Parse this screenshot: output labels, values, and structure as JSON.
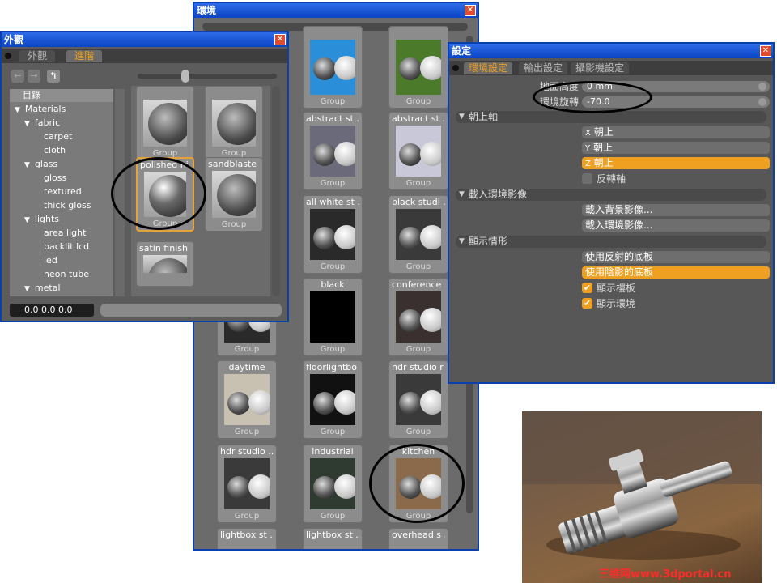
{
  "appearance": {
    "title": "外觀",
    "tabs": [
      "外觀",
      "進階"
    ],
    "tree_header": "目錄",
    "tree": [
      "Materials",
      "fabric",
      "carpet",
      "cloth",
      "glass",
      "gloss",
      "textured",
      "thick gloss",
      "lights",
      "area light",
      "backlit lcd",
      "led",
      "neon tube",
      "metal"
    ],
    "coords": "0.0   0.0   0.0",
    "thumbs": [
      {
        "label": "Group",
        "caption": ""
      },
      {
        "label": "Group",
        "caption": ""
      },
      {
        "label": "Group",
        "caption": "polished ni ..."
      },
      {
        "label": "Group",
        "caption": "sandblaste ..."
      },
      {
        "label": "",
        "caption": "satin finish ..."
      }
    ]
  },
  "environment": {
    "title": "環境",
    "thumbs": [
      {
        "caption": "",
        "label": "Group"
      },
      {
        "caption": "",
        "label": "Group"
      },
      {
        "caption": "abstract st ...",
        "label": "Group"
      },
      {
        "caption": "abstract st ...",
        "label": "Group"
      },
      {
        "caption": "all white st ...",
        "label": "Group"
      },
      {
        "caption": "black studi ...",
        "label": "Group"
      },
      {
        "caption": "",
        "label": "Group"
      },
      {
        "caption": "black",
        "label": "Group"
      },
      {
        "caption": "conference ...",
        "label": "Group"
      },
      {
        "caption": "daytime",
        "label": "Group"
      },
      {
        "caption": "floorlightbo ...",
        "label": "Group"
      },
      {
        "caption": "hdr studio r ...",
        "label": "Group"
      },
      {
        "caption": "hdr studio ...",
        "label": "Group"
      },
      {
        "caption": "industrial",
        "label": "Group"
      },
      {
        "caption": "kitchen",
        "label": "Group"
      },
      {
        "caption": "lightbox st ...",
        "label": ""
      },
      {
        "caption": "lightbox st ...",
        "label": ""
      },
      {
        "caption": "overhead s ...",
        "label": ""
      }
    ]
  },
  "settings": {
    "title": "設定",
    "tabs": [
      "環境設定",
      "輸出設定",
      "攝影機設定"
    ],
    "ground_height_label": "地面高度",
    "ground_height_value": "0 mm",
    "env_rotation_label": "環境旋轉",
    "env_rotation_value": "-70.0",
    "section_up_axis": "朝上軸",
    "x_up": "朝上",
    "y_up": "朝上",
    "z_up": "朝上",
    "axis_x": "X",
    "axis_y": "Y",
    "axis_z": "Z",
    "flip_axis": "反轉軸",
    "section_load": "載入環境影像",
    "load_background": "載入背景影像...",
    "load_environment": "載入環境影像...",
    "section_display": "顯示情形",
    "use_reflection_floor": "使用反射的底板",
    "use_shadow_floor": "使用陰影的底板",
    "show_floor": "顯示樓板",
    "show_environment": "顯示環境"
  },
  "render": {
    "watermark": "三维网www.3dportal.cn"
  }
}
